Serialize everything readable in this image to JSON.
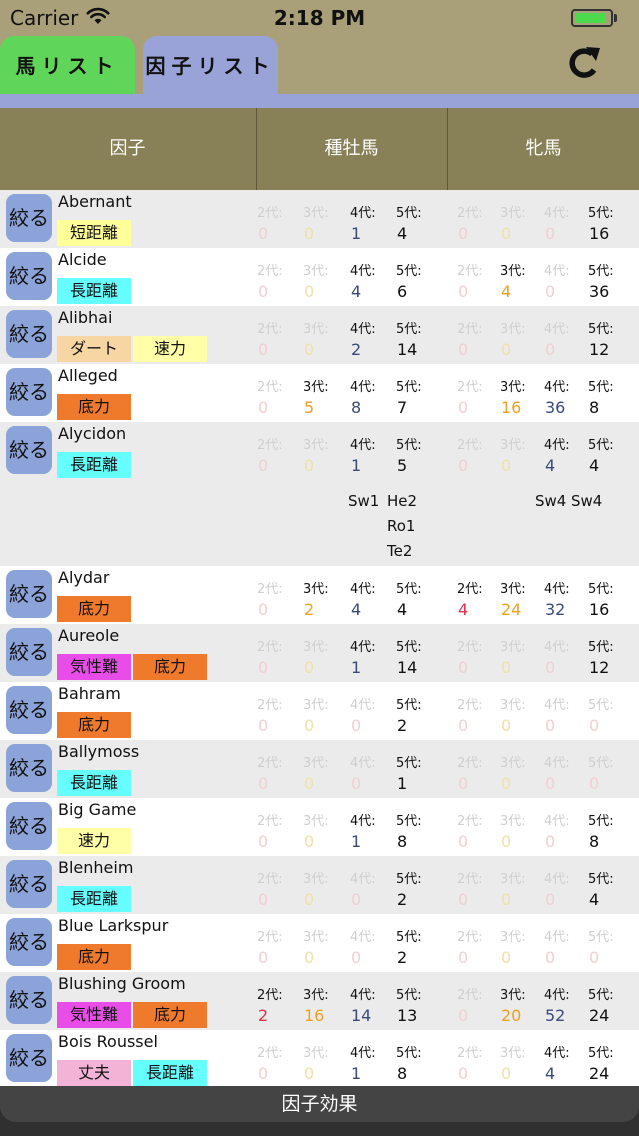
{
  "status": {
    "carrier": "Carrier",
    "time": "2:18 PM",
    "battery_level": 0.9
  },
  "tabs": [
    {
      "label": "馬リスト",
      "active": false,
      "color": "#5fd65a"
    },
    {
      "label": "因子リスト",
      "active": true,
      "color": "#9aa3d8"
    }
  ],
  "header": {
    "factor": "因子",
    "sire": "種牡馬",
    "dam": "牝馬"
  },
  "filter_label": "絞る",
  "gen_labels": [
    "2代:",
    "3代:",
    "4代:",
    "5代:"
  ],
  "tag_colors": {
    "短距離": "#ffff99",
    "長距離": "#66ffff",
    "ダート": "#f7d6a4",
    "速力": "#ffffa8",
    "底力": "#ef7a2c",
    "気性難": "#e84de8",
    "丈夫": "#f2b3d6"
  },
  "rows": [
    {
      "name": "Abernant",
      "tags": [
        "短距離"
      ],
      "sire": [
        0,
        0,
        1,
        4
      ],
      "dam": [
        0,
        0,
        0,
        16
      ]
    },
    {
      "name": "Alcide",
      "tags": [
        "長距離"
      ],
      "sire": [
        0,
        0,
        4,
        6
      ],
      "dam": [
        0,
        4,
        0,
        36
      ]
    },
    {
      "name": "Alibhai",
      "tags": [
        "ダート",
        "速力"
      ],
      "sire": [
        0,
        0,
        2,
        14
      ],
      "dam": [
        0,
        0,
        0,
        12
      ]
    },
    {
      "name": "Alleged",
      "tags": [
        "底力"
      ],
      "sire": [
        0,
        5,
        8,
        7
      ],
      "dam": [
        0,
        16,
        36,
        8
      ]
    },
    {
      "name": "Alycidon",
      "tags": [
        "長距離"
      ],
      "sire": [
        0,
        0,
        1,
        5
      ],
      "dam": [
        0,
        0,
        4,
        4
      ],
      "extra": {
        "sire_g4": [
          "Sw1"
        ],
        "sire_g5": [
          "He2",
          "Ro1",
          "Te2"
        ],
        "dam_g4": [
          "Sw4"
        ],
        "dam_g5": [
          "Sw4"
        ]
      }
    },
    {
      "name": "Alydar",
      "tags": [
        "底力"
      ],
      "sire": [
        0,
        2,
        4,
        4
      ],
      "dam": [
        4,
        24,
        32,
        16
      ]
    },
    {
      "name": "Aureole",
      "tags": [
        "気性難",
        "底力"
      ],
      "sire": [
        0,
        0,
        1,
        14
      ],
      "dam": [
        0,
        0,
        0,
        12
      ]
    },
    {
      "name": "Bahram",
      "tags": [
        "底力"
      ],
      "sire": [
        0,
        0,
        0,
        2
      ],
      "dam": [
        0,
        0,
        0,
        0
      ]
    },
    {
      "name": "Ballymoss",
      "tags": [
        "長距離"
      ],
      "sire": [
        0,
        0,
        0,
        1
      ],
      "dam": [
        0,
        0,
        0,
        0
      ]
    },
    {
      "name": "Big Game",
      "tags": [
        "速力"
      ],
      "sire": [
        0,
        0,
        1,
        8
      ],
      "dam": [
        0,
        0,
        0,
        8
      ]
    },
    {
      "name": "Blenheim",
      "tags": [
        "長距離"
      ],
      "sire": [
        0,
        0,
        0,
        2
      ],
      "dam": [
        0,
        0,
        0,
        4
      ]
    },
    {
      "name": "Blue Larkspur",
      "tags": [
        "底力"
      ],
      "sire": [
        0,
        0,
        0,
        2
      ],
      "dam": [
        0,
        0,
        0,
        0
      ]
    },
    {
      "name": "Blushing Groom",
      "tags": [
        "気性難",
        "底力"
      ],
      "sire": [
        2,
        16,
        14,
        13
      ],
      "dam": [
        0,
        20,
        52,
        24
      ]
    },
    {
      "name": "Bois Roussel",
      "tags": [
        "丈夫",
        "長距離"
      ],
      "sire": [
        0,
        0,
        1,
        8
      ],
      "dam": [
        0,
        0,
        4,
        24
      ]
    }
  ],
  "bottom_button": "因子効果"
}
